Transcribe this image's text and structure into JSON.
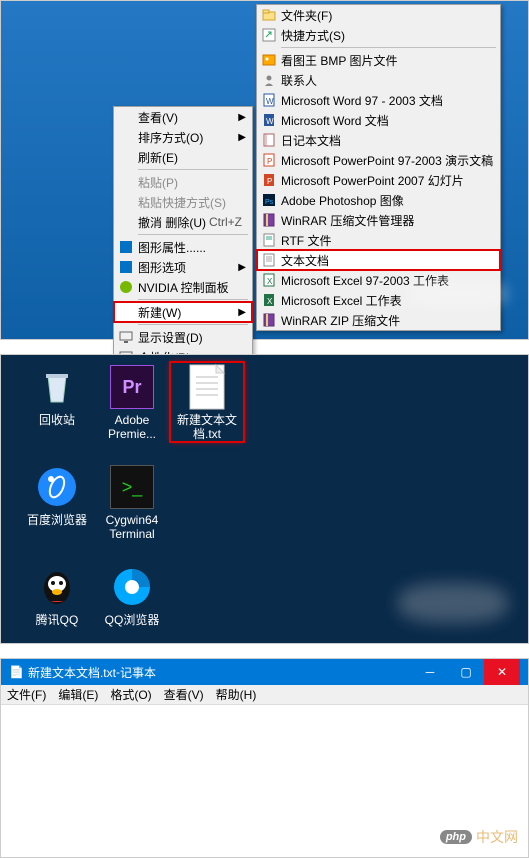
{
  "context_menu": {
    "items": [
      {
        "label": "查看(V)",
        "arrow": true
      },
      {
        "label": "排序方式(O)",
        "arrow": true
      },
      {
        "label": "刷新(E)"
      },
      "sep",
      {
        "label": "粘贴(P)",
        "disabled": true
      },
      {
        "label": "粘贴快捷方式(S)",
        "disabled": true
      },
      {
        "label": "撤消 删除(U)",
        "shortcut": "Ctrl+Z"
      },
      "sep",
      {
        "label": "图形属性......",
        "icon": "intel-icon"
      },
      {
        "label": "图形选项",
        "icon": "intel-icon",
        "arrow": true
      },
      {
        "label": "NVIDIA 控制面板",
        "icon": "nvidia-icon"
      },
      "sep",
      {
        "label": "新建(W)",
        "arrow": true,
        "highlight": true
      },
      "sep",
      {
        "label": "显示设置(D)",
        "icon": "display-icon"
      },
      {
        "label": "个性化(R)",
        "icon": "personalize-icon"
      }
    ]
  },
  "new_submenu": {
    "items": [
      {
        "label": "文件夹(F)",
        "icon": "folder-icon"
      },
      {
        "label": "快捷方式(S)",
        "icon": "shortcut-icon"
      },
      "sep",
      {
        "label": "看图王 BMP 图片文件",
        "icon": "bmp-icon"
      },
      {
        "label": "联系人",
        "icon": "contact-icon"
      },
      {
        "label": "Microsoft Word 97 - 2003 文档",
        "icon": "doc-icon"
      },
      {
        "label": "Microsoft Word 文档",
        "icon": "docx-icon"
      },
      {
        "label": "日记本文档",
        "icon": "journal-icon"
      },
      {
        "label": "Microsoft PowerPoint 97-2003 演示文稿",
        "icon": "ppt-icon"
      },
      {
        "label": "Microsoft PowerPoint 2007 幻灯片",
        "icon": "pptx-icon"
      },
      {
        "label": "Adobe Photoshop 图像",
        "icon": "psd-icon"
      },
      {
        "label": "WinRAR 压缩文件管理器",
        "icon": "rar-icon"
      },
      {
        "label": "RTF 文件",
        "icon": "rtf-icon"
      },
      {
        "label": "文本文档",
        "icon": "txt-icon",
        "highlight": true
      },
      {
        "label": "Microsoft Excel 97-2003 工作表",
        "icon": "xls-icon"
      },
      {
        "label": "Microsoft Excel 工作表",
        "icon": "xlsx-icon"
      },
      {
        "label": "WinRAR ZIP 压缩文件",
        "icon": "zip-icon"
      }
    ]
  },
  "desktop_icons": [
    {
      "name": "回收站",
      "name2": "",
      "type": "recycle-bin"
    },
    {
      "name": "Adobe",
      "name2": "Premie...",
      "type": "premiere"
    },
    {
      "name": "新建文本文",
      "name2": "档.txt",
      "type": "txtfile",
      "selected": true
    },
    {
      "name": "百度浏览器",
      "name2": "",
      "type": "baidu"
    },
    {
      "name": "Cygwin64",
      "name2": "Terminal",
      "type": "cygwin"
    },
    {
      "name": "腾讯QQ",
      "name2": "",
      "type": "qq"
    },
    {
      "name": "QQ浏览器",
      "name2": "",
      "type": "qqbrowser"
    }
  ],
  "notepad": {
    "title_filename": "新建文本文档.txt",
    "title_app": "记事本",
    "sep": " - ",
    "menu": [
      "文件(F)",
      "编辑(E)",
      "格式(O)",
      "查看(V)",
      "帮助(H)"
    ]
  },
  "watermark": {
    "badge": "php",
    "text": "中文网"
  }
}
